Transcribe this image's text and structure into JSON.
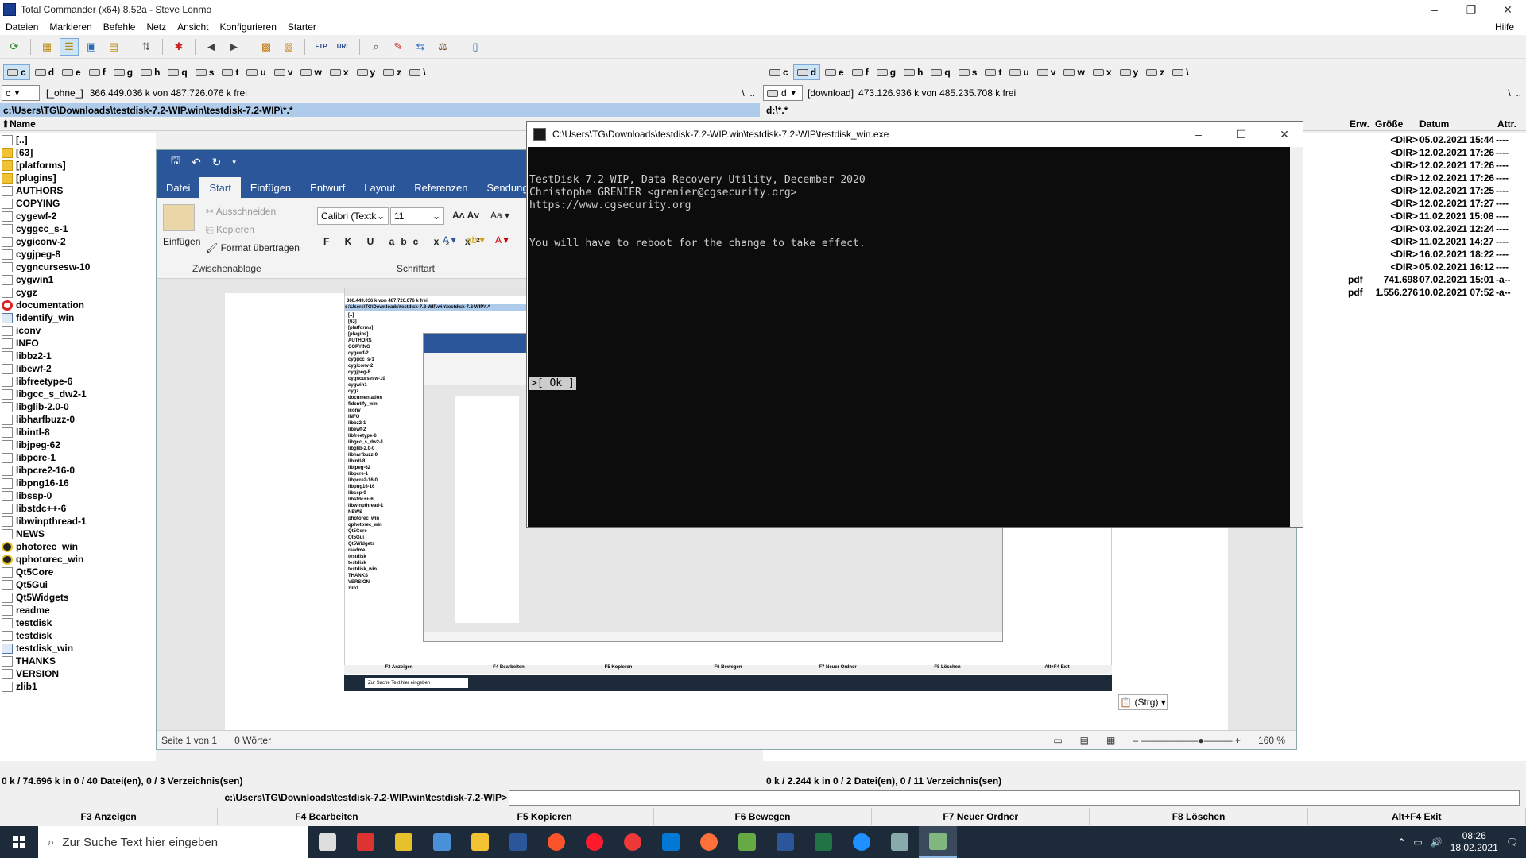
{
  "window": {
    "title": "Total Commander (x64) 8.52a - Steve Lonmo"
  },
  "menu": [
    "Dateien",
    "Markieren",
    "Befehle",
    "Netz",
    "Ansicht",
    "Konfigurieren",
    "Starter"
  ],
  "menu_help": "Hilfe",
  "drives": [
    "c",
    "d",
    "e",
    "f",
    "g",
    "h",
    "q",
    "s",
    "t",
    "u",
    "v",
    "w",
    "x",
    "y",
    "z",
    "\\"
  ],
  "left": {
    "drive": "c",
    "volume": "[_ohne_]",
    "free": "366.449.036 k von 487.726.076 k frei",
    "path": "c:\\Users\\TG\\Downloads\\testdisk-7.2-WIP.win\\testdisk-7.2-WIP\\*.*",
    "header_name": "Name",
    "files": [
      {
        "name": "[..]",
        "icon": "up-icon"
      },
      {
        "name": "[63]",
        "icon": "folder-icon"
      },
      {
        "name": "[platforms]",
        "icon": "folder-icon"
      },
      {
        "name": "[plugins]",
        "icon": "folder-icon"
      },
      {
        "name": "AUTHORS",
        "icon": "file-icon"
      },
      {
        "name": "COPYING",
        "icon": "file-icon"
      },
      {
        "name": "cygewf-2",
        "icon": "file-icon"
      },
      {
        "name": "cyggcc_s-1",
        "icon": "file-icon"
      },
      {
        "name": "cygiconv-2",
        "icon": "file-icon"
      },
      {
        "name": "cygjpeg-8",
        "icon": "file-icon"
      },
      {
        "name": "cygncursesw-10",
        "icon": "file-icon"
      },
      {
        "name": "cygwin1",
        "icon": "file-icon"
      },
      {
        "name": "cygz",
        "icon": "file-icon"
      },
      {
        "name": "documentation",
        "icon": "red-circle-icon"
      },
      {
        "name": "fidentify_win",
        "icon": "exe-icon"
      },
      {
        "name": "iconv",
        "icon": "file-icon"
      },
      {
        "name": "INFO",
        "icon": "file-icon"
      },
      {
        "name": "libbz2-1",
        "icon": "file-icon"
      },
      {
        "name": "libewf-2",
        "icon": "file-icon"
      },
      {
        "name": "libfreetype-6",
        "icon": "file-icon"
      },
      {
        "name": "libgcc_s_dw2-1",
        "icon": "file-icon"
      },
      {
        "name": "libglib-2.0-0",
        "icon": "file-icon"
      },
      {
        "name": "libharfbuzz-0",
        "icon": "file-icon"
      },
      {
        "name": "libintl-8",
        "icon": "file-icon"
      },
      {
        "name": "libjpeg-62",
        "icon": "file-icon"
      },
      {
        "name": "libpcre-1",
        "icon": "file-icon"
      },
      {
        "name": "libpcre2-16-0",
        "icon": "file-icon"
      },
      {
        "name": "libpng16-16",
        "icon": "file-icon"
      },
      {
        "name": "libssp-0",
        "icon": "file-icon"
      },
      {
        "name": "libstdc++-6",
        "icon": "file-icon"
      },
      {
        "name": "libwinpthread-1",
        "icon": "file-icon"
      },
      {
        "name": "NEWS",
        "icon": "file-icon"
      },
      {
        "name": "photorec_win",
        "icon": "target-icon"
      },
      {
        "name": "qphotorec_win",
        "icon": "target-icon"
      },
      {
        "name": "Qt5Core",
        "icon": "file-icon"
      },
      {
        "name": "Qt5Gui",
        "icon": "file-icon"
      },
      {
        "name": "Qt5Widgets",
        "icon": "file-icon"
      },
      {
        "name": "readme",
        "icon": "file-icon"
      },
      {
        "name": "testdisk",
        "icon": "file-icon"
      },
      {
        "name": "testdisk",
        "icon": "file-icon"
      },
      {
        "name": "testdisk_win",
        "icon": "exe-icon"
      },
      {
        "name": "THANKS",
        "icon": "file-icon"
      },
      {
        "name": "VERSION",
        "icon": "file-icon"
      },
      {
        "name": "zlib1",
        "icon": "file-icon"
      }
    ],
    "status": "0 k / 74.696 k in 0 / 40 Datei(en), 0 / 3 Verzeichnis(sen)"
  },
  "right": {
    "drive": "d",
    "volume": "[download]",
    "free": "473.126.936 k von 485.235.708 k frei",
    "path": "d:\\*.*",
    "header_ext": "Erw.",
    "header_size": "Größe",
    "header_date": "Datum",
    "header_attr": "Attr.",
    "files": [
      {
        "ext": "",
        "size": "<DIR>",
        "date": "05.02.2021 15:44",
        "attr": "----"
      },
      {
        "ext": "",
        "size": "<DIR>",
        "date": "12.02.2021 17:26",
        "attr": "----"
      },
      {
        "ext": "",
        "size": "<DIR>",
        "date": "12.02.2021 17:26",
        "attr": "----"
      },
      {
        "ext": "",
        "size": "<DIR>",
        "date": "12.02.2021 17:26",
        "attr": "----"
      },
      {
        "ext": "",
        "size": "<DIR>",
        "date": "12.02.2021 17:25",
        "attr": "----"
      },
      {
        "ext": "",
        "size": "<DIR>",
        "date": "12.02.2021 17:27",
        "attr": "----"
      },
      {
        "ext": "",
        "size": "<DIR>",
        "date": "11.02.2021 15:08",
        "attr": "----"
      },
      {
        "ext": "",
        "size": "<DIR>",
        "date": "03.02.2021 12:24",
        "attr": "----"
      },
      {
        "ext": "",
        "size": "<DIR>",
        "date": "11.02.2021 14:27",
        "attr": "----"
      },
      {
        "ext": "",
        "size": "<DIR>",
        "date": "16.02.2021 18:22",
        "attr": "----"
      },
      {
        "ext": "",
        "size": "<DIR>",
        "date": "05.02.2021 16:12",
        "attr": "----"
      },
      {
        "ext": "pdf",
        "size": "741.698",
        "date": "07.02.2021 15:01",
        "attr": "-a--"
      },
      {
        "ext": "pdf",
        "size": "1.556.276",
        "date": "10.02.2021 07:52",
        "attr": "-a--"
      }
    ],
    "status": "0 k / 2.244 k in 0 / 2 Datei(en), 0 / 11 Verzeichnis(sen)"
  },
  "cmdline": {
    "path": "c:\\Users\\TG\\Downloads\\testdisk-7.2-WIP.win\\testdisk-7.2-WIP>"
  },
  "fkeys": [
    "F3 Anzeigen",
    "F4 Bearbeiten",
    "F5 Kopieren",
    "F6 Bewegen",
    "F7 Neuer Ordner",
    "F8 Löschen",
    "Alt+F4 Exit"
  ],
  "word": {
    "tabs": [
      "Datei",
      "Start",
      "Einfügen",
      "Entwurf",
      "Layout",
      "Referenzen",
      "Sendunge"
    ],
    "active_tab": "Start",
    "clipboard": {
      "paste": "Einfügen",
      "cut": "Ausschneiden",
      "copy": "Kopieren",
      "format": "Format übertragen",
      "group": "Zwischenablage"
    },
    "font": {
      "name": "Calibri (Textk",
      "size": "11",
      "group": "Schriftart"
    },
    "status_page": "Seite 1 von 1",
    "status_words": "0 Wörter",
    "zoom": "160 %",
    "paste_options": "(Strg)"
  },
  "console": {
    "title": "C:\\Users\\TG\\Downloads\\testdisk-7.2-WIP.win\\testdisk-7.2-WIP\\testdisk_win.exe",
    "lines": [
      "TestDisk 7.2-WIP, Data Recovery Utility, December 2020",
      "Christophe GRENIER <grenier@cgsecurity.org>",
      "https://www.cgsecurity.org",
      "",
      "",
      "You will have to reboot for the change to take effect."
    ],
    "prompt": ">",
    "ok_label": "[ Ok ]"
  },
  "taskbar": {
    "search_placeholder": "Zur Suche Text hier eingeben",
    "time": "08:26",
    "date": "18.02.2021",
    "apps": [
      "task-view-icon",
      "app-red-icon",
      "app-yellow-icon",
      "app-blue-icon",
      "explorer-icon",
      "save-icon",
      "brave-icon",
      "opera-icon",
      "vivaldi-icon",
      "outlook-icon",
      "firefox-icon",
      "app-green-icon",
      "word-icon",
      "excel-icon",
      "app-lightning-icon",
      "app-scanner-icon",
      "total-commander-icon"
    ]
  },
  "colors": {
    "word_blue": "#2b579a",
    "console_bg": "#0c0c0c",
    "path_active": "#aecbeb"
  }
}
